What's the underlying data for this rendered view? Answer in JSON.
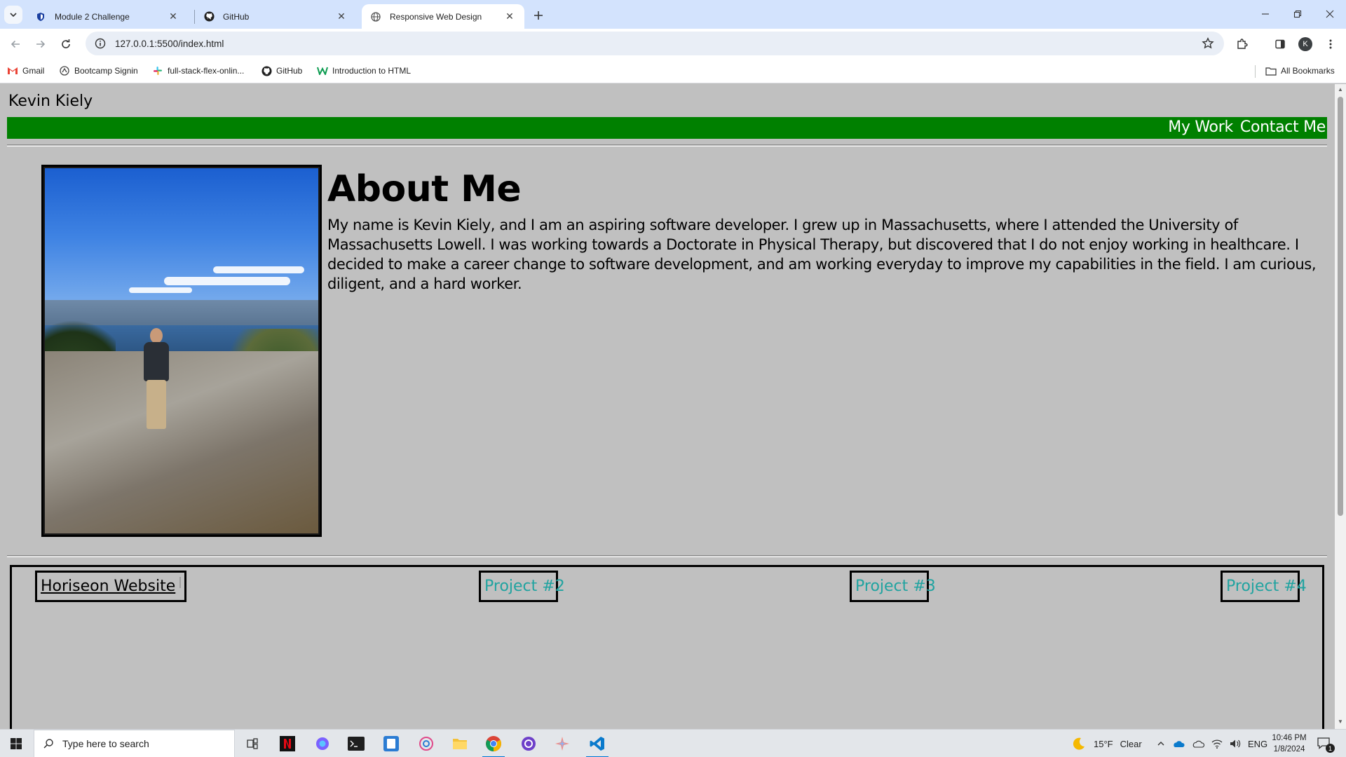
{
  "browser": {
    "tabs": [
      {
        "title": "Module 2 Challenge",
        "icon": "shield-icon",
        "active": false
      },
      {
        "title": "GitHub",
        "icon": "github-icon",
        "active": false
      },
      {
        "title": "Responsive Web Design",
        "icon": "globe-icon",
        "active": true
      }
    ],
    "url": "127.0.0.1:5500/index.html",
    "profile_initial": "K",
    "bookmarks": [
      {
        "label": "Gmail",
        "icon": "gmail-icon"
      },
      {
        "label": "Bootcamp Signin",
        "icon": "bootcamp-icon"
      },
      {
        "label": "full-stack-flex-onlin...",
        "icon": "slack-icon"
      },
      {
        "label": "GitHub",
        "icon": "github-icon"
      },
      {
        "label": "Introduction to HTML",
        "icon": "w3-icon"
      }
    ],
    "all_bookmarks_label": "All Bookmarks"
  },
  "page": {
    "site_name": "Kevin Kiely",
    "nav": [
      "My Work",
      "Contact Me"
    ],
    "nav_color": "#008000",
    "background": "#c0c0c0",
    "about_heading": "About Me",
    "about_text": "My name is Kevin Kiely, and I am an aspiring software developer. I grew up in Massachusetts, where I attended the University of Massachusetts Lowell. I was working towards a Doctorate in Physical Therapy, but discovered that I do not enjoy working in healthcare. I decided to make a career change to software development, and am working everyday to improve my capabilities in the field. I am curious, diligent, and a hard worker.",
    "projects": [
      {
        "label": "Horiseon Website"
      },
      {
        "label": "Project #2"
      },
      {
        "label": "Project #3"
      },
      {
        "label": "Project #4"
      }
    ],
    "project_link_color": "#20a3a0"
  },
  "taskbar": {
    "search_placeholder": "Type here to search",
    "apps": [
      "task-view-icon",
      "netflix-icon",
      "copilot-icon",
      "terminal-icon",
      "text-editor-icon",
      "snipping-tool-icon",
      "file-explorer-icon",
      "chrome-icon",
      "github-desktop-icon",
      "gemini-icon",
      "vscode-icon"
    ],
    "weather_temp": "15°F",
    "weather_desc": "Clear",
    "language": "ENG",
    "time": "10:46 PM",
    "date": "1/8/2024",
    "notification_count": "1"
  }
}
